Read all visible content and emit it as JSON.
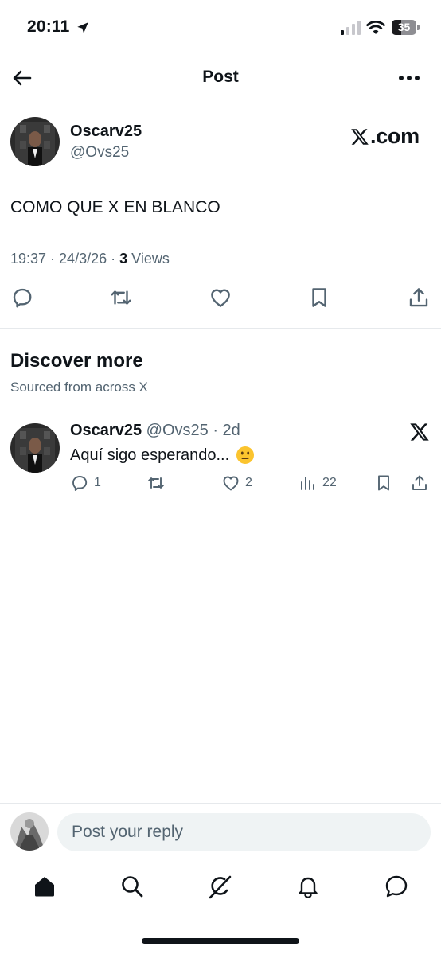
{
  "status_bar": {
    "time": "20:11",
    "battery": "35"
  },
  "header": {
    "title": "Post"
  },
  "post": {
    "author_name": "Oscarv25",
    "author_handle": "@Ovs25",
    "source_logo": ".com",
    "text": "COMO QUE X EN BLANCO",
    "time": "19:37",
    "date": "24/3/26",
    "views_count": "3",
    "views_label": "Views"
  },
  "discover": {
    "title": "Discover more",
    "subtitle": "Sourced from across X",
    "card": {
      "author_name": "Oscarv25",
      "author_handle": "@Ovs25",
      "age": "2d",
      "text": "Aquí sigo esperando...",
      "replies": "1",
      "likes": "2",
      "views": "22"
    }
  },
  "reply": {
    "placeholder": "Post your reply"
  },
  "icons": {
    "status": [
      "location-arrow-icon",
      "signal-icon",
      "wifi-icon",
      "battery-icon"
    ],
    "header": [
      "back-arrow-icon",
      "more-icon"
    ],
    "actions": [
      "reply-icon",
      "repost-icon",
      "like-icon",
      "bookmark-icon",
      "share-icon",
      "views-icon"
    ],
    "tabs": [
      "home-icon",
      "search-icon",
      "grok-icon",
      "notifications-icon",
      "messages-icon"
    ]
  },
  "colors": {
    "text": "#0f1419",
    "secondary": "#536471",
    "divider": "#e6e9ec",
    "input_bg": "#eff3f4"
  }
}
